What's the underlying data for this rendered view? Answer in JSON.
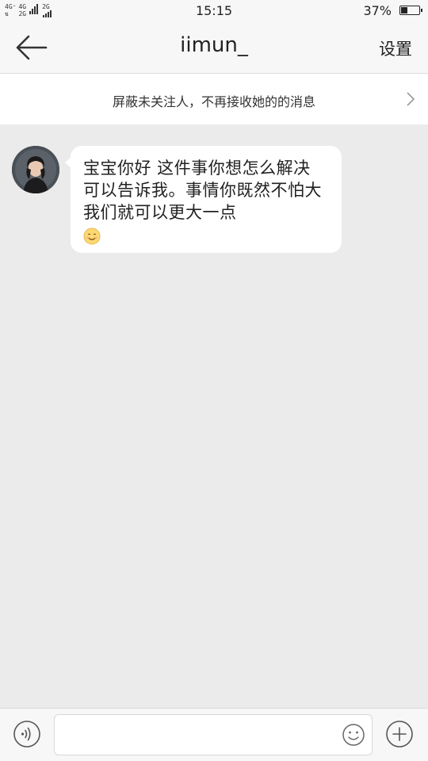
{
  "status_bar": {
    "network_1": "4G⁺",
    "network_2": "4G",
    "network_3": "2G",
    "time": "15:15",
    "battery_percent": "37%",
    "battery_level": 0.37
  },
  "nav": {
    "title": "iimun_",
    "settings_label": "设置"
  },
  "block_bar": {
    "text": "屏蔽未关注人，不再接收她的的消息"
  },
  "conversation": {
    "messages": [
      {
        "sender": "incoming",
        "text": "宝宝你好 这件事你想怎么解决 可以告诉我。事情你既然不怕大 我们就可以更大一点",
        "emoji": "smiling-face-icon"
      }
    ]
  },
  "input_bar": {
    "value": "",
    "placeholder": ""
  }
}
